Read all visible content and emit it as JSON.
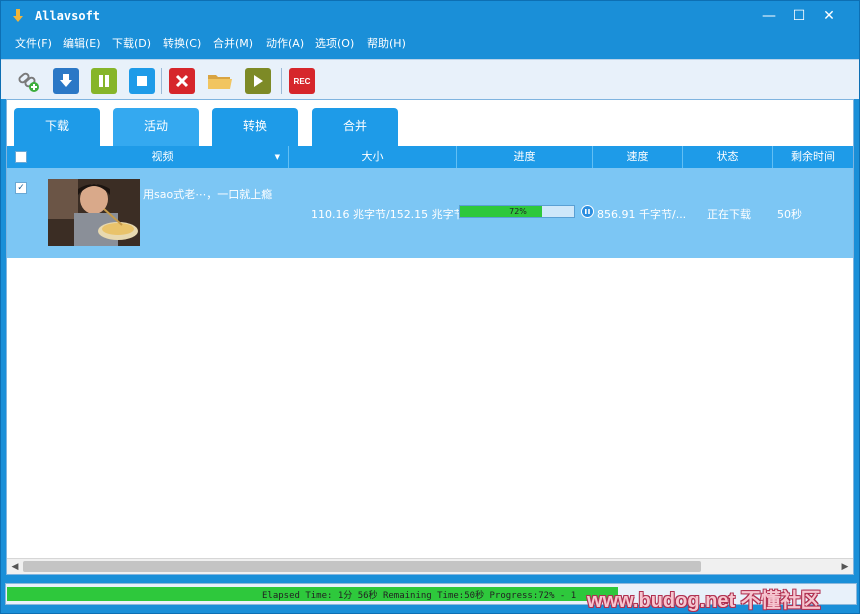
{
  "app": {
    "title": "Allavsoft",
    "window_controls": {
      "minimize": "—",
      "maximize": "☐",
      "close": "✕"
    }
  },
  "menu": [
    {
      "label": "文件(F)"
    },
    {
      "label": "编辑(E)"
    },
    {
      "label": "下载(D)"
    },
    {
      "label": "转换(C)"
    },
    {
      "label": "合并(M)"
    },
    {
      "label": "动作(A)"
    },
    {
      "label": "选项(O)"
    },
    {
      "label": "帮助(H)"
    }
  ],
  "toolbar": {
    "icons": [
      "add-link-icon",
      "download-icon",
      "pause-icon",
      "stop-icon",
      "delete-icon",
      "open-folder-icon",
      "play-icon",
      "record-icon"
    ],
    "rec_label": "REC"
  },
  "tabs": [
    {
      "label": "下载"
    },
    {
      "label": "活动"
    },
    {
      "label": "转换"
    },
    {
      "label": "合并"
    }
  ],
  "table": {
    "headers": [
      "视频",
      "大小",
      "进度",
      "速度",
      "状态",
      "剩余时间"
    ],
    "rows": [
      {
        "checked": "✓",
        "title": "用sao式老⋯，一口就上瘾",
        "size": "110.16 兆字节/152.15 兆字节",
        "progress_label": "72%",
        "progress": 0.72,
        "speed": "856.91 千字节/...",
        "status": "正在下载",
        "remaining": "50秒"
      }
    ]
  },
  "statusbar": {
    "text": "Elapsed Time: 1分 56秒 Remaining Time:50秒 Progress:72% - 1",
    "progress": 0.72
  },
  "watermark": "www.budog.net 不懂社区",
  "colors": {
    "accent": "#1a8fd8",
    "tab": "#1e9be8",
    "row_selected": "#7cc6f4",
    "progress": "#2ec83c"
  }
}
